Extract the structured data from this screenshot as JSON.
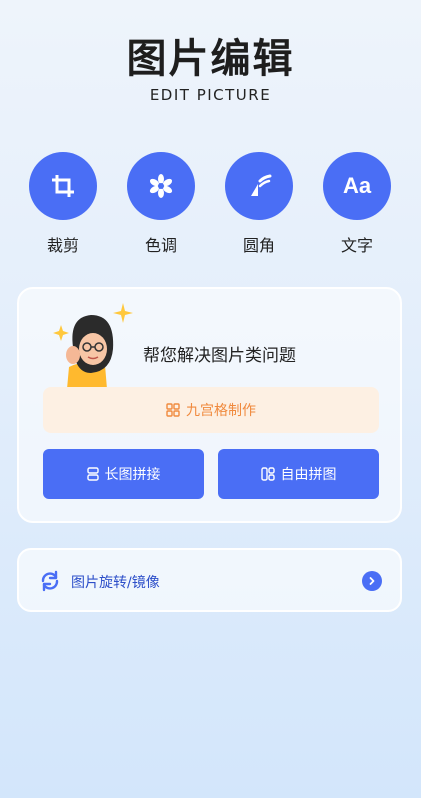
{
  "header": {
    "title": "图片编辑",
    "subtitle": "EDIT PICTURE"
  },
  "tools": [
    {
      "label": "裁剪",
      "icon": "crop-icon"
    },
    {
      "label": "色调",
      "icon": "tone-icon"
    },
    {
      "label": "圆角",
      "icon": "rounded-corner-icon"
    },
    {
      "label": "文字",
      "icon": "text-icon"
    }
  ],
  "tool_text_icon_glyph": "Aa",
  "card": {
    "text": "帮您解决图片类问题",
    "grid_button_label": "九宫格制作",
    "long_button_label": "长图拼接",
    "free_button_label": "自由拼图"
  },
  "rotate": {
    "label": "图片旋转/镜像",
    "icon": "rotate-icon",
    "arrow_icon": "chevron-right-icon"
  },
  "colors": {
    "accent": "#4a6ef5",
    "orange": "#f08a3e",
    "orange_bg": "#fdf0e3"
  }
}
